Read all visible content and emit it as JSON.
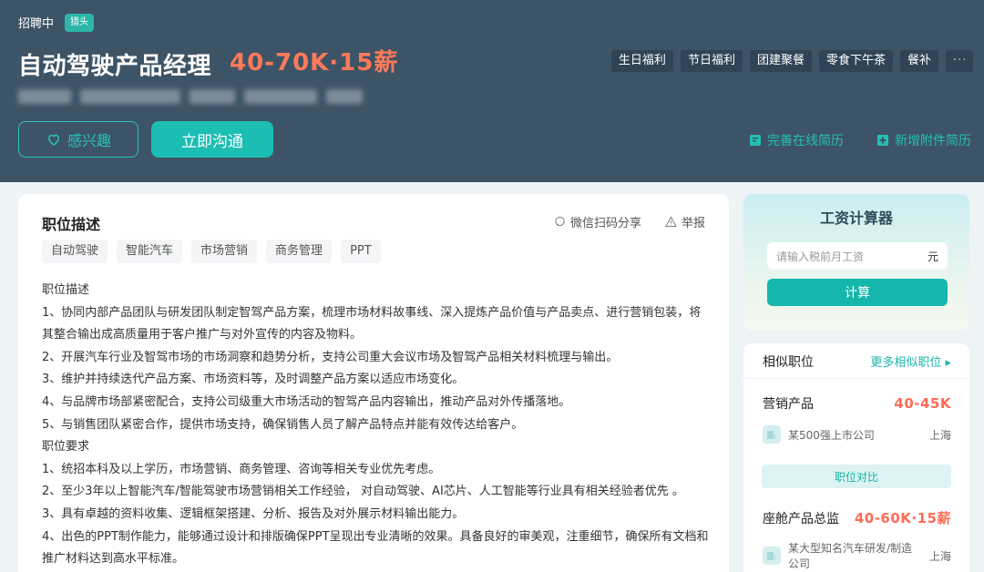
{
  "header": {
    "status": "招聘中",
    "badge": "猎头",
    "job_title": "自动驾驶产品经理",
    "salary": "40-70K·15薪",
    "welfare_tags": [
      "生日福利",
      "节日福利",
      "团建聚餐",
      "零食下午茶",
      "餐补"
    ],
    "welfare_more": "···",
    "interest_button": "感兴趣",
    "chat_button": "立即沟通",
    "complete_resume": "完善在线简历",
    "add_attachment": "新增附件简历"
  },
  "job_card": {
    "title": "职位描述",
    "share": "微信扫码分享",
    "report": "举报",
    "tags": [
      "自动驾驶",
      "智能汽车",
      "市场营销",
      "商务管理",
      "PPT"
    ],
    "description": [
      "职位描述",
      "1、协同内部产品团队与研发团队制定智驾产品方案，梳理市场材料故事线、深入提炼产品价值与产品卖点、进行营销包装，将其整合输出成高质量用于客户推广与对外宣传的内容及物料。",
      "2、开展汽车行业及智驾市场的市场洞察和趋势分析，支持公司重大会议市场及智驾产品相关材料梳理与输出。",
      "3、维护并持续迭代产品方案、市场资料等，及时调整产品方案以适应市场变化。",
      "4、与品牌市场部紧密配合，支持公司级重大市场活动的智驾产品内容输出，推动产品对外传播落地。",
      "5、与销售团队紧密合作，提供市场支持，确保销售人员了解产品特点并能有效传达给客户。",
      "职位要求",
      "1、统招本科及以上学历，市场营销、商务管理、咨询等相关专业优先考虑。",
      "2、至少3年以上智能汽车/智能驾驶市场营销相关工作经验， 对自动驾驶、AI芯片、人工智能等行业具有相关经验者优先 。",
      "3、具有卓越的资料收集、逻辑框架搭建、分析、报告及对外展示材料输出能力。",
      "4、出色的PPT制作能力，能够通过设计和排版确保PPT呈现出专业清晰的效果。具备良好的审美观，注重细节，确保所有文档和推广材料达到高水平标准。"
    ]
  },
  "calculator": {
    "title": "工资计算器",
    "placeholder": "请输入税前月工资",
    "unit": "元",
    "button": "计算"
  },
  "similar": {
    "title": "相似职位",
    "more": "更多相似职位",
    "jobs": [
      {
        "name": "营销产品",
        "salary": "40-45K",
        "company": "某500强上市公司",
        "city": "上海"
      },
      {
        "name": "座舱产品总监",
        "salary": "40-60K·15薪",
        "company": "某大型知名汽车研发/制造公司",
        "city": "上海"
      }
    ],
    "compare_button": "职位对比"
  },
  "colors": {
    "header_bg": "#3d5467",
    "accent": "#1cbdb2",
    "salary": "#ff7a59"
  }
}
